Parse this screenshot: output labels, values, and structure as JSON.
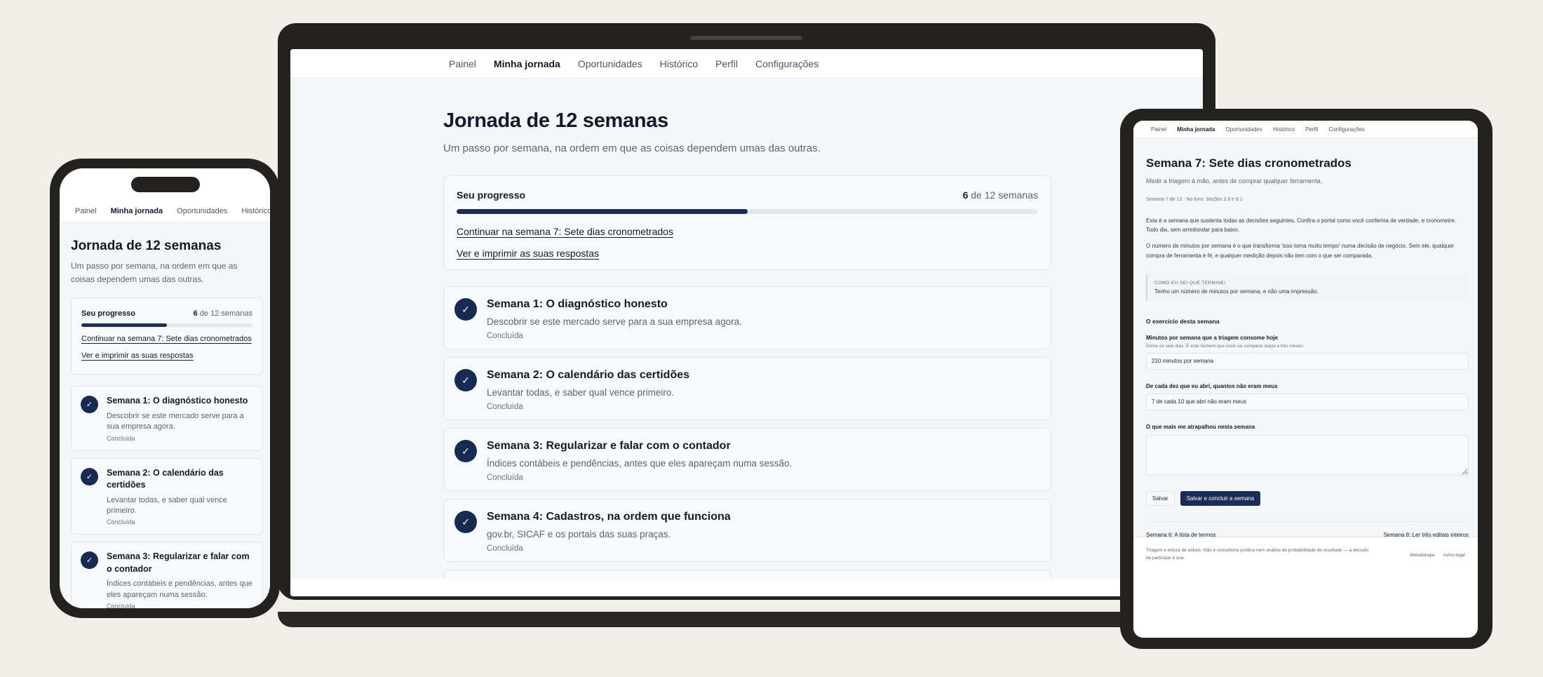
{
  "nav": {
    "items": [
      "Painel",
      "Minha jornada",
      "Oportunidades",
      "Histórico",
      "Perfil",
      "Configurações"
    ],
    "active": "Minha jornada"
  },
  "journey": {
    "title": "Jornada de 12 semanas",
    "subtitle": "Um passo por semana, na ordem em que as coisas dependem umas das outras.",
    "progress": {
      "label": "Seu progresso",
      "done": "6",
      "count_suffix": " de 12 semanas",
      "fraction": 0.5,
      "continue_link": "Continuar na semana 7: Sete dias cronometrados",
      "print_link": "Ver e imprimir as suas respostas"
    },
    "weeks": [
      {
        "title": "Semana 1: O diagnóstico honesto",
        "desc": "Descobrir se este mercado serve para a sua empresa agora.",
        "status": "Concluída"
      },
      {
        "title": "Semana 2: O calendário das certidões",
        "desc": "Levantar todas, e saber qual vence primeiro.",
        "status": "Concluída"
      },
      {
        "title": "Semana 3: Regularizar e falar com o contador",
        "desc": "Índices contábeis e pendências, antes que eles apareçam numa sessão.",
        "status": "Concluída"
      },
      {
        "title": "Semana 4: Cadastros, na ordem que funciona",
        "desc": "gov.br, SICAF e os portais das suas praças.",
        "status": "Concluída"
      }
    ],
    "check_glyph": "✓"
  },
  "week7": {
    "title": "Semana 7: Sete dias cronometrados",
    "subtitle": "Medir a triagem à mão, antes de comprar qualquer ferramenta.",
    "meta": "Semana 7 de 12 · No livro: Seções 2.6 e 8.1",
    "para1": "Esta é a semana que sustenta todas as decisões seguintes. Confira o portal como você conferiria de verdade, e cronometre. Todo dia, sem arredondar para baixo.",
    "para2": "O número de minutos por semana é o que transforma 'isso toma muito tempo' numa decisão de negócio. Sem ele, qualquer compra de ferramenta é fé, e qualquer medição depois não tem com o que ser comparada.",
    "callout_label": "COMO EU SEI QUE TERMINEI",
    "callout_text": "Tenho um número de minutos por semana, e não uma impressão.",
    "exercise_title": "O exercício desta semana",
    "field1_label": "Minutos por semana que a triagem consome hoje",
    "field1_hint": "Some os sete dias. É este número que você vai comparar daqui a três meses.",
    "field1_value": "210 minutos por semana",
    "field2_label": "De cada dez que eu abri, quantos não eram meus",
    "field2_value": "7 de cada 10 que abri não eram meus",
    "field3_label": "O que mais me atrapalhou nesta semana",
    "save_label": "Salvar",
    "complete_label": "Salvar e concluir a semana",
    "prev_link": "Semana 6: A lista de termos",
    "next_link": "Semana 8: Ler três editais inteiros",
    "footer_note": "Triagem e leitura de editais. Não é consultoria jurídica nem análise de probabilidade de resultado — a decisão de participar é sua.",
    "footer_links": [
      "Metodologia",
      "Aviso legal"
    ]
  },
  "colors": {
    "accent": "#1a2d57",
    "background": "#f1efe9",
    "device": "#24221f"
  }
}
